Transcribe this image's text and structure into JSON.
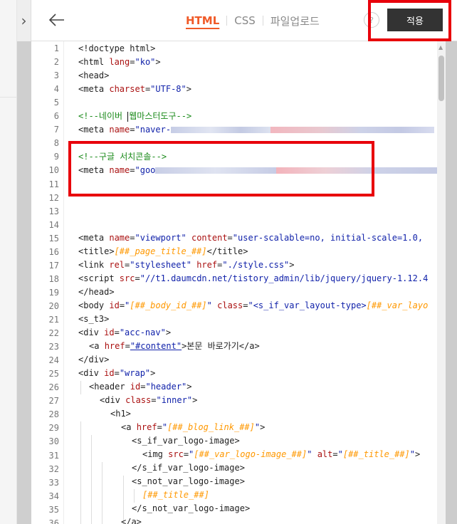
{
  "nav": {
    "collapse_icon": "chevron-right-icon",
    "collapse_glyph": "›"
  },
  "header": {
    "back_glyph": "←",
    "tabs": [
      {
        "label": "HTML",
        "active": true
      },
      {
        "label": "CSS",
        "active": false
      },
      {
        "label": "파일업로드",
        "active": false
      }
    ],
    "help_glyph": "?",
    "apply_label": "적용"
  },
  "editor": {
    "line_numbers": [
      "1",
      "2",
      "3",
      "4",
      "5",
      "6",
      "7",
      "8",
      "9",
      "10",
      "11",
      "12",
      "13",
      "14",
      "15",
      "16",
      "17",
      "18",
      "19",
      "20",
      "21",
      "22",
      "23",
      "24",
      "25",
      "26",
      "27",
      "28",
      "29",
      "30",
      "31",
      "32",
      "33",
      "34",
      "35",
      "36"
    ],
    "lines": {
      "l1": "<!doctype html>",
      "l2a": "<html ",
      "l2b": "lang",
      "l2c": "=",
      "l2d": "\"ko\"",
      "l2e": ">",
      "l3": "<head>",
      "l4a": "<meta ",
      "l4b": "charset",
      "l4c": "=",
      "l4d": "\"UTF-8\"",
      "l4e": ">",
      "l6a": "<!--네이버 ",
      "l6b": "웹마스터도구-->",
      "l7a": "<meta ",
      "l7b": "name",
      "l7c": "=",
      "l7d": "\"naver-",
      "l9": "<!--구글 서치콘솔-->",
      "l10a": "<meta ",
      "l10b": "name",
      "l10c": "=",
      "l10d": "\"goo",
      "l15a": "<meta ",
      "l15b": "name",
      "l15c": "=",
      "l15d": "\"viewport\"",
      "l15e": " content",
      "l15f": "=",
      "l15g": "\"user-scalable=no, initial-scale=1.0,",
      "l16a": "<title>",
      "l16b": "[##_page_title_##]",
      "l16c": "</title>",
      "l17a": "<link ",
      "l17b": "rel",
      "l17c": "=",
      "l17d": "\"stylesheet\"",
      "l17e": " href",
      "l17f": "=",
      "l17g": "\"./style.css\"",
      "l17h": ">",
      "l18a": "<script ",
      "l18b": "src",
      "l18c": "=",
      "l18d": "\"//t1.daumcdn.net/tistory_admin/lib/jquery/jquery-1.12.4",
      "l19": "</head>",
      "l20a": "<body ",
      "l20b": "id",
      "l20c": "=",
      "l20d": "\"",
      "l20e": "[##_body_id_##]",
      "l20f": "\"",
      "l20g": " class",
      "l20h": "=",
      "l20i": "\"<s_if_var_layout-type>",
      "l20j": "[##_var_layo",
      "l21": "<s_t3>",
      "l22a": "<div ",
      "l22b": "id",
      "l22c": "=",
      "l22d": "\"acc-nav\"",
      "l22e": ">",
      "l23a": "<a ",
      "l23b": "href",
      "l23c": "=",
      "l23d": "\"#content\"",
      "l23e": ">본문 바로가기</a>",
      "l24": "</div>",
      "l25a": "<div ",
      "l25b": "id",
      "l25c": "=",
      "l25d": "\"wrap\"",
      "l25e": ">",
      "l26a": "<header ",
      "l26b": "id",
      "l26c": "=",
      "l26d": "\"header\"",
      "l26e": ">",
      "l27a": "<div ",
      "l27b": "class",
      "l27c": "=",
      "l27d": "\"inner\"",
      "l27e": ">",
      "l28": "<h1>",
      "l29a": "<a ",
      "l29b": "href",
      "l29c": "=",
      "l29d": "\"",
      "l29e": "[##_blog_link_##]",
      "l29f": "\"",
      "l29g": ">",
      "l30": "<s_if_var_logo-image>",
      "l31a": "<img ",
      "l31b": "src",
      "l31c": "=",
      "l31d": "\"",
      "l31e": "[##_var_logo-image_##]",
      "l31f": "\"",
      "l31g": " alt",
      "l31h": "=",
      "l31i": "\"",
      "l31j": "[##_title_##]",
      "l31k": "\"",
      "l31l": ">",
      "l32": "</s_if_var_logo-image>",
      "l33": "<s_not_var_logo-image>",
      "l34": "[##_title_##]",
      "l35": "</s_not_var_logo-image>",
      "l36": "</a>"
    }
  },
  "colors": {
    "accent": "#f05a28",
    "highlight_box": "#e8000b",
    "apply_button": "#333333",
    "tag": "#222222",
    "attribute": "#aa1111",
    "string": "#1122aa",
    "template_var": "#ff9800",
    "comment": "#1a8a1a"
  }
}
